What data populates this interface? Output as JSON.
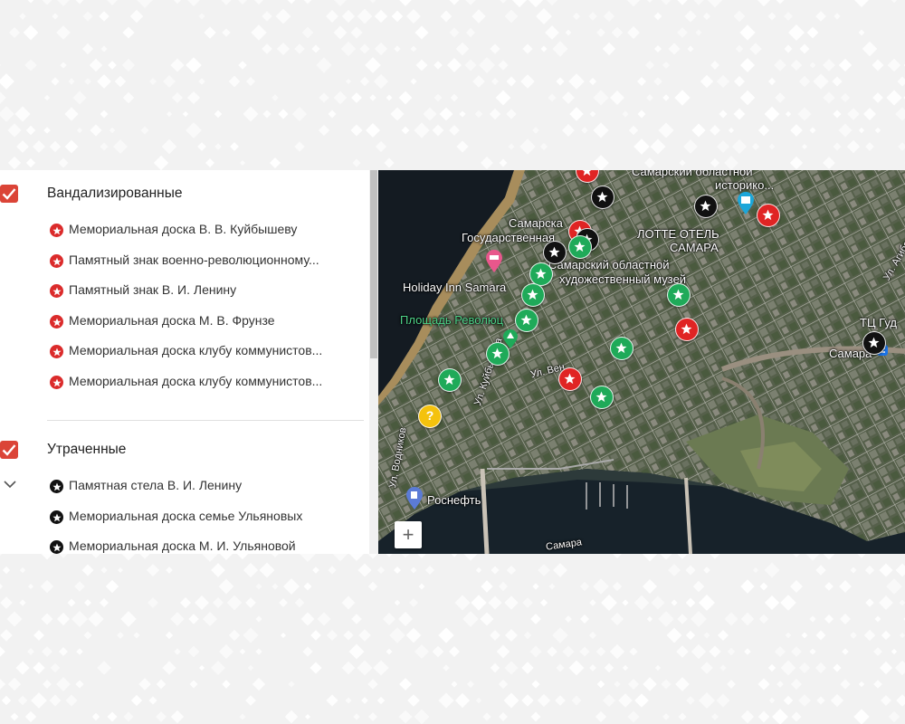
{
  "layers": [
    {
      "title": "Вандализированные",
      "checked": true,
      "color": "#db4437",
      "items": [
        "Мемориальная доска В. В. Куйбышеву",
        "Памятный знак военно-революционному...",
        "Памятный знак В. И. Ленину",
        "Мемориальная доска М. В. Фрунзе",
        "Мемориальная доска клубу коммунистов...",
        "Мемориальная доска клубу коммунистов..."
      ]
    },
    {
      "title": "Утраченные",
      "checked": true,
      "color": "#111111",
      "items": [
        "Памятная стела В. И. Ленину",
        "Мемориальная доска семье Ульяновых",
        "Мемориальная доска М. И. Ульяновой"
      ]
    }
  ],
  "map": {
    "labels": {
      "regional_museum": "Самарский областной",
      "regional_museum_2": "историко...",
      "samara_state": "Самарска",
      "samara_state_2": "Государственная",
      "lotte_1": "ЛОТТЕ ОТЕЛЬ",
      "lotte_2": "САМАРА",
      "art_museum_1": "Самарский областной",
      "art_museum_2": "художественный музей",
      "holiday_inn": "Holiday Inn Samara",
      "revolution_square": "Площадь Революц",
      "tc_gud": "ТЦ Гуд",
      "samara_station": "Самара",
      "rosneft": "Роснефть",
      "street_kuibysheva": "Ул. Куйбышева",
      "street_ven": "Ул. Вен",
      "street_vodnikov": "Ул. Водников",
      "street_artsybashev": "Ул. Агибалова",
      "river": "Самара"
    },
    "zoom_in": "+",
    "yellow_marker_glyph": "?"
  }
}
